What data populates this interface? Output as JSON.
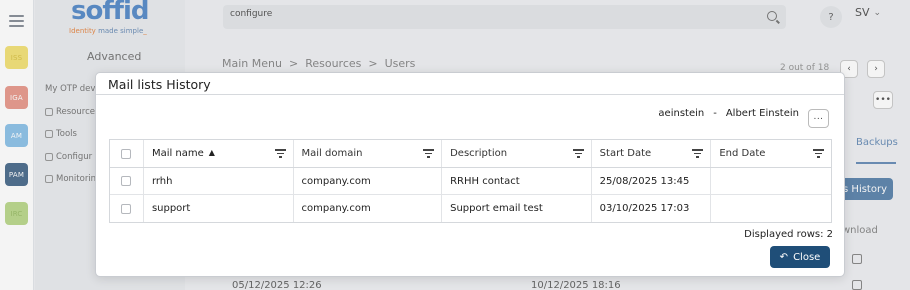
{
  "app": {
    "logo_text": "soffid",
    "logo_tagline_a": "Identity",
    "logo_tagline_b": "made simple",
    "section_title": "Advanced"
  },
  "rail": {
    "badges": [
      {
        "label": "ISS",
        "color": "#f3e27a"
      },
      {
        "label": "IGA",
        "color": "#e89c8f"
      },
      {
        "label": "AM",
        "color": "#8fc3e8"
      },
      {
        "label": "PAM",
        "color": "#4f6f8f"
      },
      {
        "label": "IRC",
        "color": "#bcd88e"
      }
    ]
  },
  "sidebar": {
    "items": [
      {
        "label": "My OTP dev"
      },
      {
        "label": "Resource"
      },
      {
        "label": "Tools"
      },
      {
        "label": "Configur"
      },
      {
        "label": "Monitorin"
      }
    ]
  },
  "header": {
    "search_value": "configure",
    "help_label": "?",
    "user_initials": "SV"
  },
  "breadcrumb": [
    "Main Menu",
    ">",
    "Resources",
    ">",
    "Users"
  ],
  "pager": {
    "count_text": "2 out of 18"
  },
  "background": {
    "tab_label": "Backups",
    "history_button": "s History",
    "download_label": "wnload",
    "row_left": "05/12/2025 12:26",
    "row_right": "10/12/2025 18:16"
  },
  "modal": {
    "title": "Mail lists History",
    "user_id": "aeinstein",
    "user_separator": "-",
    "user_name": "Albert Einstein",
    "more_label": "...",
    "columns": [
      "Mail name",
      "Mail domain",
      "Description",
      "Start Date",
      "End Date"
    ],
    "sort_column": "Mail name",
    "rows": [
      {
        "mail_name": "rrhh",
        "mail_domain": "company.com",
        "description": "RRHH contact",
        "start_date": "25/08/2025 13:45",
        "end_date": ""
      },
      {
        "mail_name": "support",
        "mail_domain": "company.com",
        "description": "Support email test",
        "start_date": "03/10/2025 17:03",
        "end_date": ""
      }
    ],
    "displayed_rows_text": "Displayed rows: 2",
    "close_label": "Close"
  }
}
